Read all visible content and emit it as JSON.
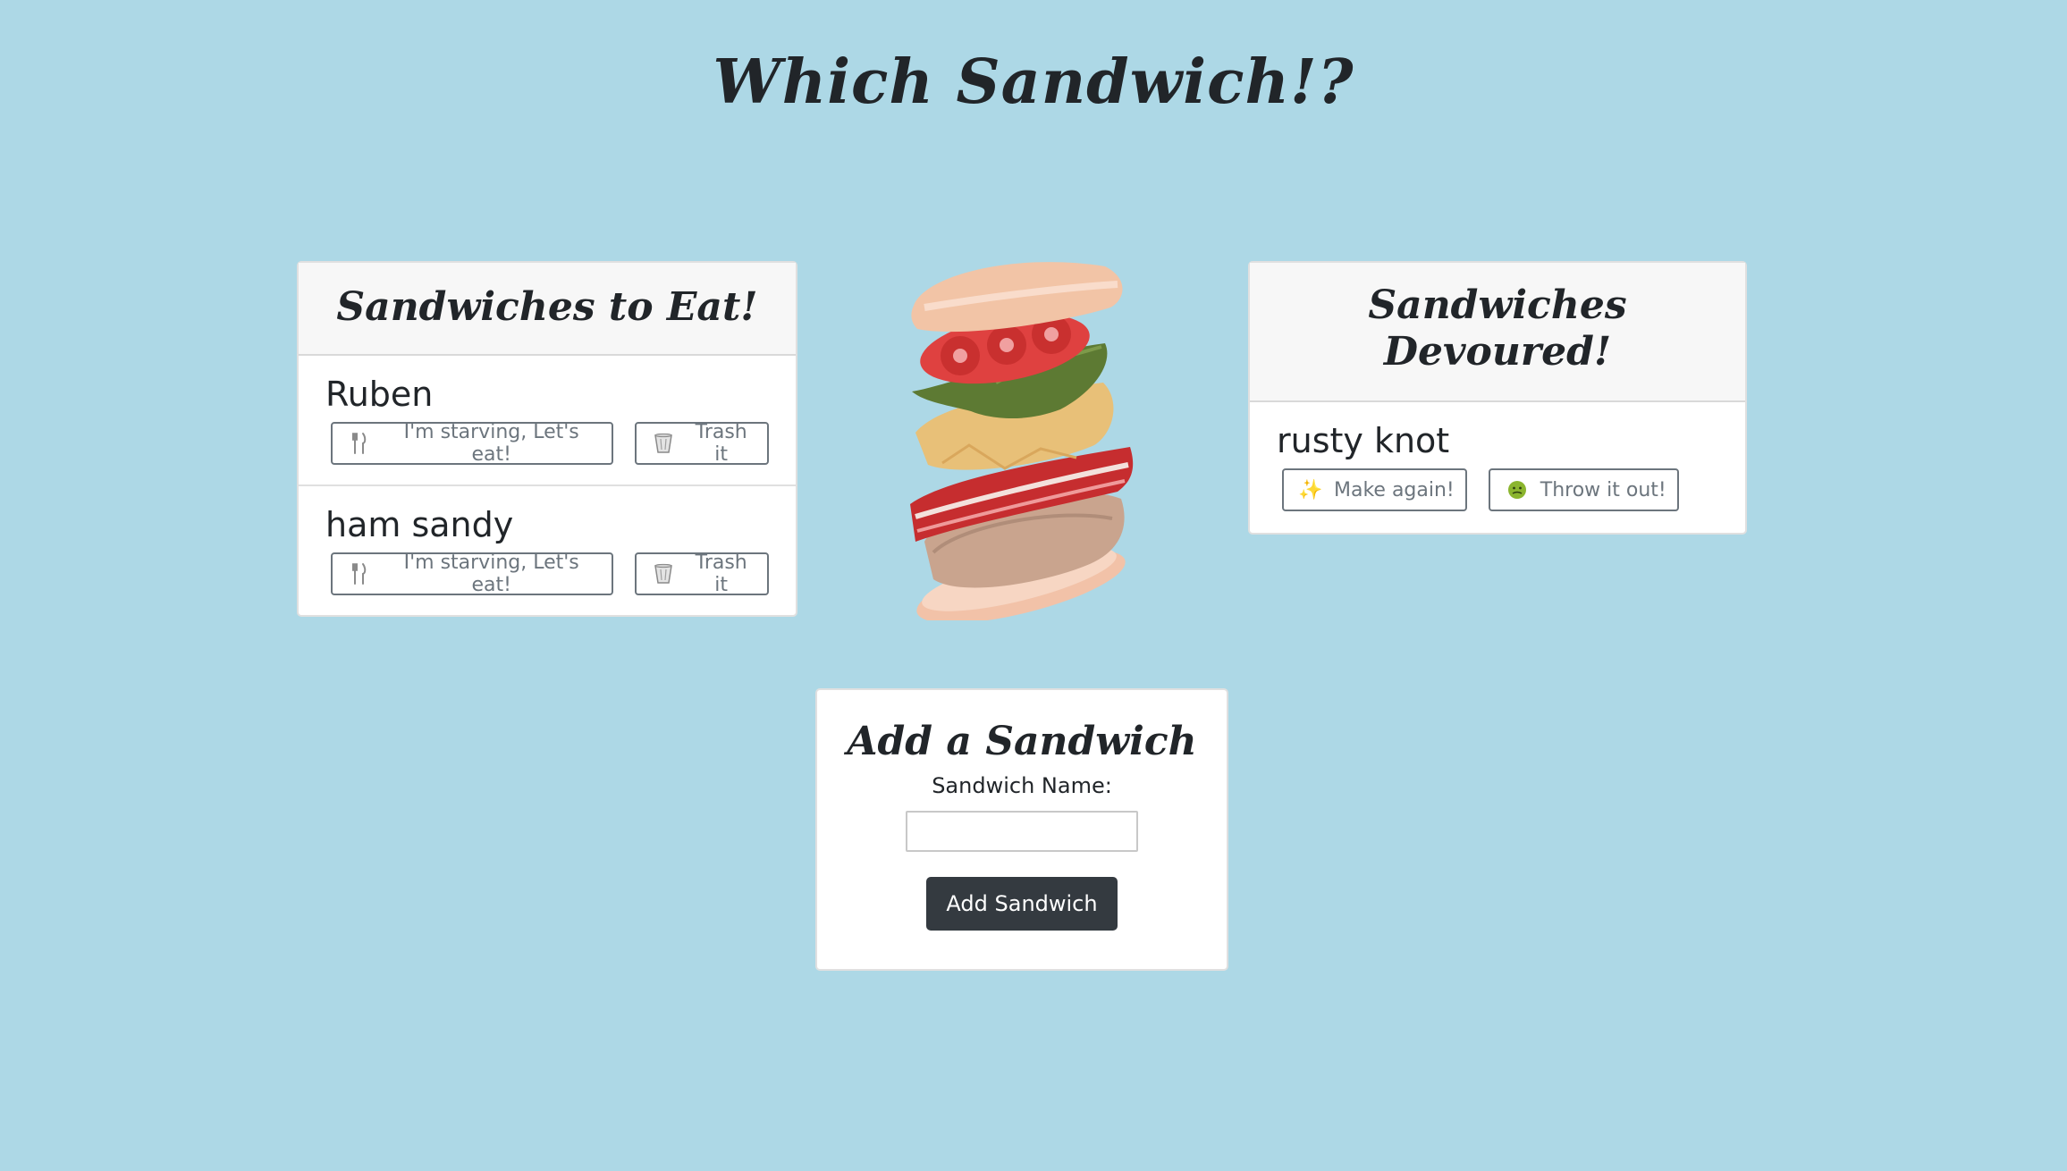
{
  "page": {
    "title": "Which Sandwich!?"
  },
  "to_eat": {
    "header": "Sandwiches to Eat!",
    "eat_label": "I'm starving, Let's eat!",
    "trash_label": "Trash it",
    "eat_icon": "fork-knife-icon",
    "trash_icon": "trash-can-icon",
    "items": [
      {
        "name": "Ruben"
      },
      {
        "name": "ham sandy"
      }
    ]
  },
  "devoured": {
    "header_line1": "Sandwiches",
    "header_line2": "Devoured!",
    "again_label": "Make again!",
    "throw_label": "Throw it out!",
    "again_icon": "sparkles-icon",
    "throw_icon": "sick-face-icon",
    "items": [
      {
        "name": "rusty knot"
      }
    ]
  },
  "add_form": {
    "title": "Add a Sandwich",
    "name_label": "Sandwich Name:",
    "name_value": "",
    "submit_label": "Add Sandwich"
  },
  "colors": {
    "background": "#add8e6",
    "dark_button": "#343a40",
    "outline_button": "#6c757d"
  }
}
